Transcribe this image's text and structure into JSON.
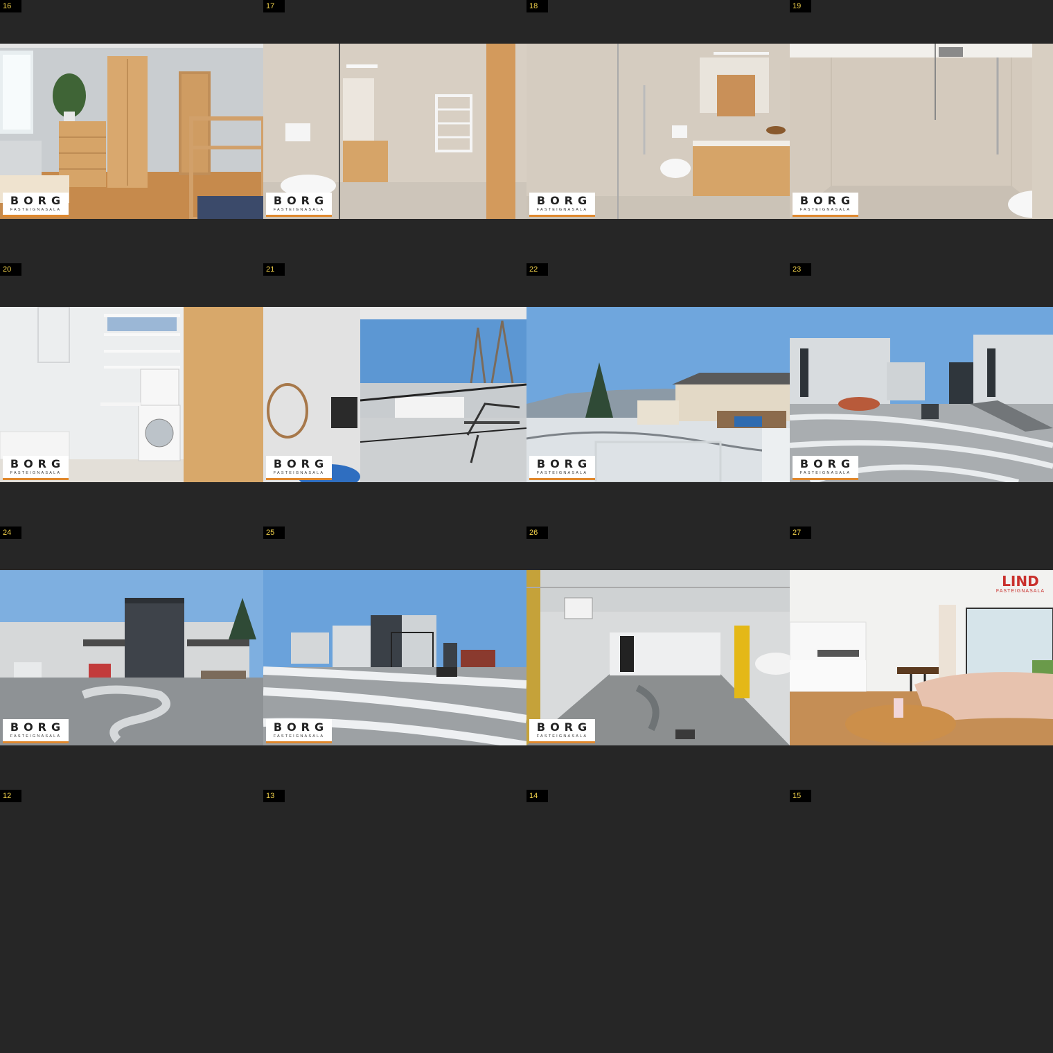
{
  "tiles": [
    {
      "index": "16",
      "logo": "BORG",
      "logo_sub": "FASTEIGNASALA",
      "scene": "bedroom with wardrobe, dresser and bunk bed"
    },
    {
      "index": "17",
      "logo": "BORG",
      "logo_sub": "FASTEIGNASALA",
      "scene": "bathroom with toilet, vanity and towel radiator"
    },
    {
      "index": "18",
      "logo": "BORG",
      "logo_sub": "FASTEIGNASALA",
      "scene": "bathroom with glass shower and vanity"
    },
    {
      "index": "19",
      "logo": "BORG",
      "logo_sub": "FASTEIGNASALA",
      "scene": "walk-in shower"
    },
    {
      "index": "20",
      "logo": "BORG",
      "logo_sub": "FASTEIGNASALA",
      "scene": "laundry room with washer and dryer"
    },
    {
      "index": "21",
      "logo": "BORG",
      "logo_sub": "FASTEIGNASALA",
      "scene": "balcony with grill and chairs"
    },
    {
      "index": "22",
      "logo": "BORG",
      "logo_sub": "FASTEIGNASALA",
      "scene": "view over snowy neighbourhood"
    },
    {
      "index": "23",
      "logo": "BORG",
      "logo_sub": "FASTEIGNASALA",
      "scene": "apartment buildings and snowy driveway"
    },
    {
      "index": "24",
      "logo": "BORG",
      "logo_sub": "FASTEIGNASALA",
      "scene": "building exterior with parking lot"
    },
    {
      "index": "25",
      "logo": "BORG",
      "logo_sub": "FASTEIGNASALA",
      "scene": "building exterior from snowy street"
    },
    {
      "index": "26",
      "logo": "BORG",
      "logo_sub": "FASTEIGNASALA",
      "scene": "underground garage"
    },
    {
      "index": "27",
      "logo": "LIND",
      "logo_sub": "FASTEIGNASALA",
      "scene": "open living room with kitchen and sofa"
    },
    {
      "index": "12"
    },
    {
      "index": "13"
    },
    {
      "index": "14"
    },
    {
      "index": "15"
    }
  ],
  "colors": {
    "background": "#262626",
    "index_text": "#f2d24b",
    "borg_accent": "#e0882d",
    "lind_red": "#c9302c"
  }
}
